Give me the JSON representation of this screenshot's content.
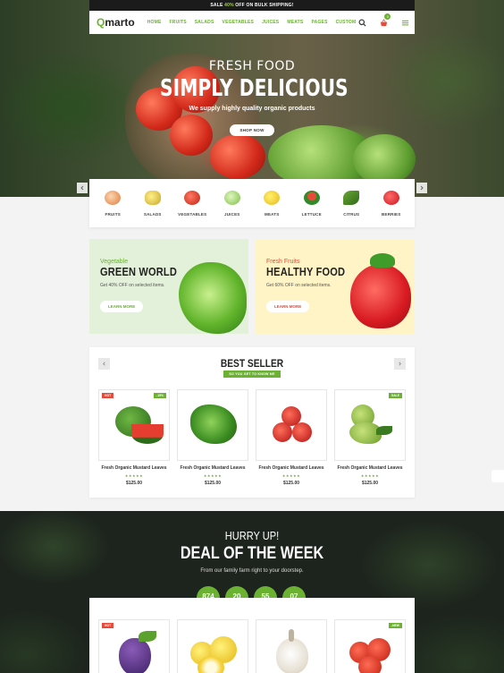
{
  "topbar": {
    "pre": "SALE ",
    "highlight": "40%",
    "post": " OFF ON BULK SHIPPING!"
  },
  "brand": {
    "logo_q": "Q",
    "logo_rest": "marto"
  },
  "nav": {
    "items": [
      "HOME",
      "FRUITS",
      "SALADS",
      "VEGETABLES",
      "JUICES",
      "MEATS",
      "PAGES",
      "CUSTOM"
    ],
    "cart_count": "0",
    "icons": [
      "search-icon",
      "basket-icon",
      "menu-icon"
    ]
  },
  "hero": {
    "subtitle": "FRESH FOOD",
    "title": "SIMPLY DELICIOUS",
    "description": "We supply highly quality organic products",
    "button": "SHOP NOW"
  },
  "categories": [
    {
      "label": "FRUITS",
      "color": "#f0b27a"
    },
    {
      "label": "SALADS",
      "color": "#e2c84a"
    },
    {
      "label": "VEGETABLES",
      "color": "#d8392b"
    },
    {
      "label": "JUICES",
      "color": "#a5d86a"
    },
    {
      "label": "MEATS",
      "color": "#f2cf2b"
    },
    {
      "label": "LETTUCE",
      "color": "#3f9b3a"
    },
    {
      "label": "CITRUS",
      "color": "#4f8a2b"
    },
    {
      "label": "BERRIES",
      "color": "#d6262a"
    }
  ],
  "banners": [
    {
      "subtitle": "Vegetable",
      "title": "GREEN WORLD",
      "description": "Get 40% OFF on selected items.",
      "button": "LEARN MORE"
    },
    {
      "subtitle": "Fresh Fruits",
      "title": "HEALTHY FOOD",
      "description": "Get 60% OFF on selected items.",
      "button": "LEARN MORE"
    }
  ],
  "best_seller": {
    "title": "BEST SELLER",
    "tag": "SO YOU GET TO KNOW ME BETTER",
    "products": [
      {
        "name": "Fresh Organic Mustard Leaves",
        "price": "$125.00",
        "badge_left": "HOT",
        "badge_right": "-15%",
        "stars": "★★★★★"
      },
      {
        "name": "Fresh Organic Mustard Leaves",
        "price": "$125.00",
        "badge_left": "",
        "badge_right": "",
        "stars": "★★★★★"
      },
      {
        "name": "Fresh Organic Mustard Leaves",
        "price": "$125.00",
        "badge_left": "",
        "badge_right": "",
        "stars": "★★★★★"
      },
      {
        "name": "Fresh Organic Mustard Leaves",
        "price": "$125.00",
        "badge_left": "",
        "badge_right": "SALE",
        "stars": "★★★★★"
      }
    ]
  },
  "deal": {
    "subtitle": "HURRY UP!",
    "title": "DEAL OF THE WEEK",
    "description": "From our family farm right to your doorstep.",
    "countdown": [
      {
        "value": "874",
        "label": "DAYS"
      },
      {
        "value": "20",
        "label": "HRS"
      },
      {
        "value": "55",
        "label": "MINS"
      },
      {
        "value": "07",
        "label": "SECS"
      }
    ],
    "badges": {
      "first": "HOT",
      "last": "-NEW"
    }
  },
  "colors": {
    "accent": "#6bb233",
    "hot": "#e64a3b",
    "dark": "#1b1b1b"
  }
}
